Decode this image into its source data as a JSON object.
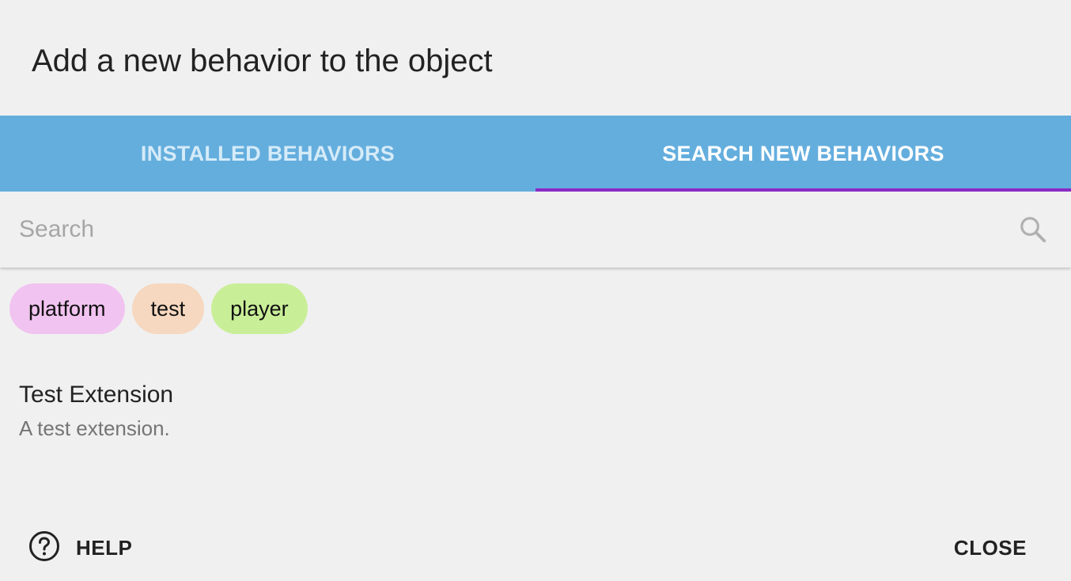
{
  "dialog": {
    "title": "Add a new behavior to the object"
  },
  "tabs": [
    {
      "label": "INSTALLED BEHAVIORS",
      "active": false
    },
    {
      "label": "SEARCH NEW BEHAVIORS",
      "active": true
    }
  ],
  "search": {
    "placeholder": "Search",
    "value": "",
    "icon": "search-icon"
  },
  "tags": [
    {
      "label": "platform",
      "color": "#f1c3f0"
    },
    {
      "label": "test",
      "color": "#f6d8c0"
    },
    {
      "label": "player",
      "color": "#c9ee98"
    }
  ],
  "results": [
    {
      "title": "Test Extension",
      "description": "A test extension."
    }
  ],
  "footer": {
    "help_label": "HELP",
    "help_icon": "help-circle-icon",
    "close_label": "CLOSE"
  },
  "colors": {
    "tab_bar": "#64aede",
    "tab_indicator": "#8a2bc6",
    "background": "#f0f0f0"
  }
}
